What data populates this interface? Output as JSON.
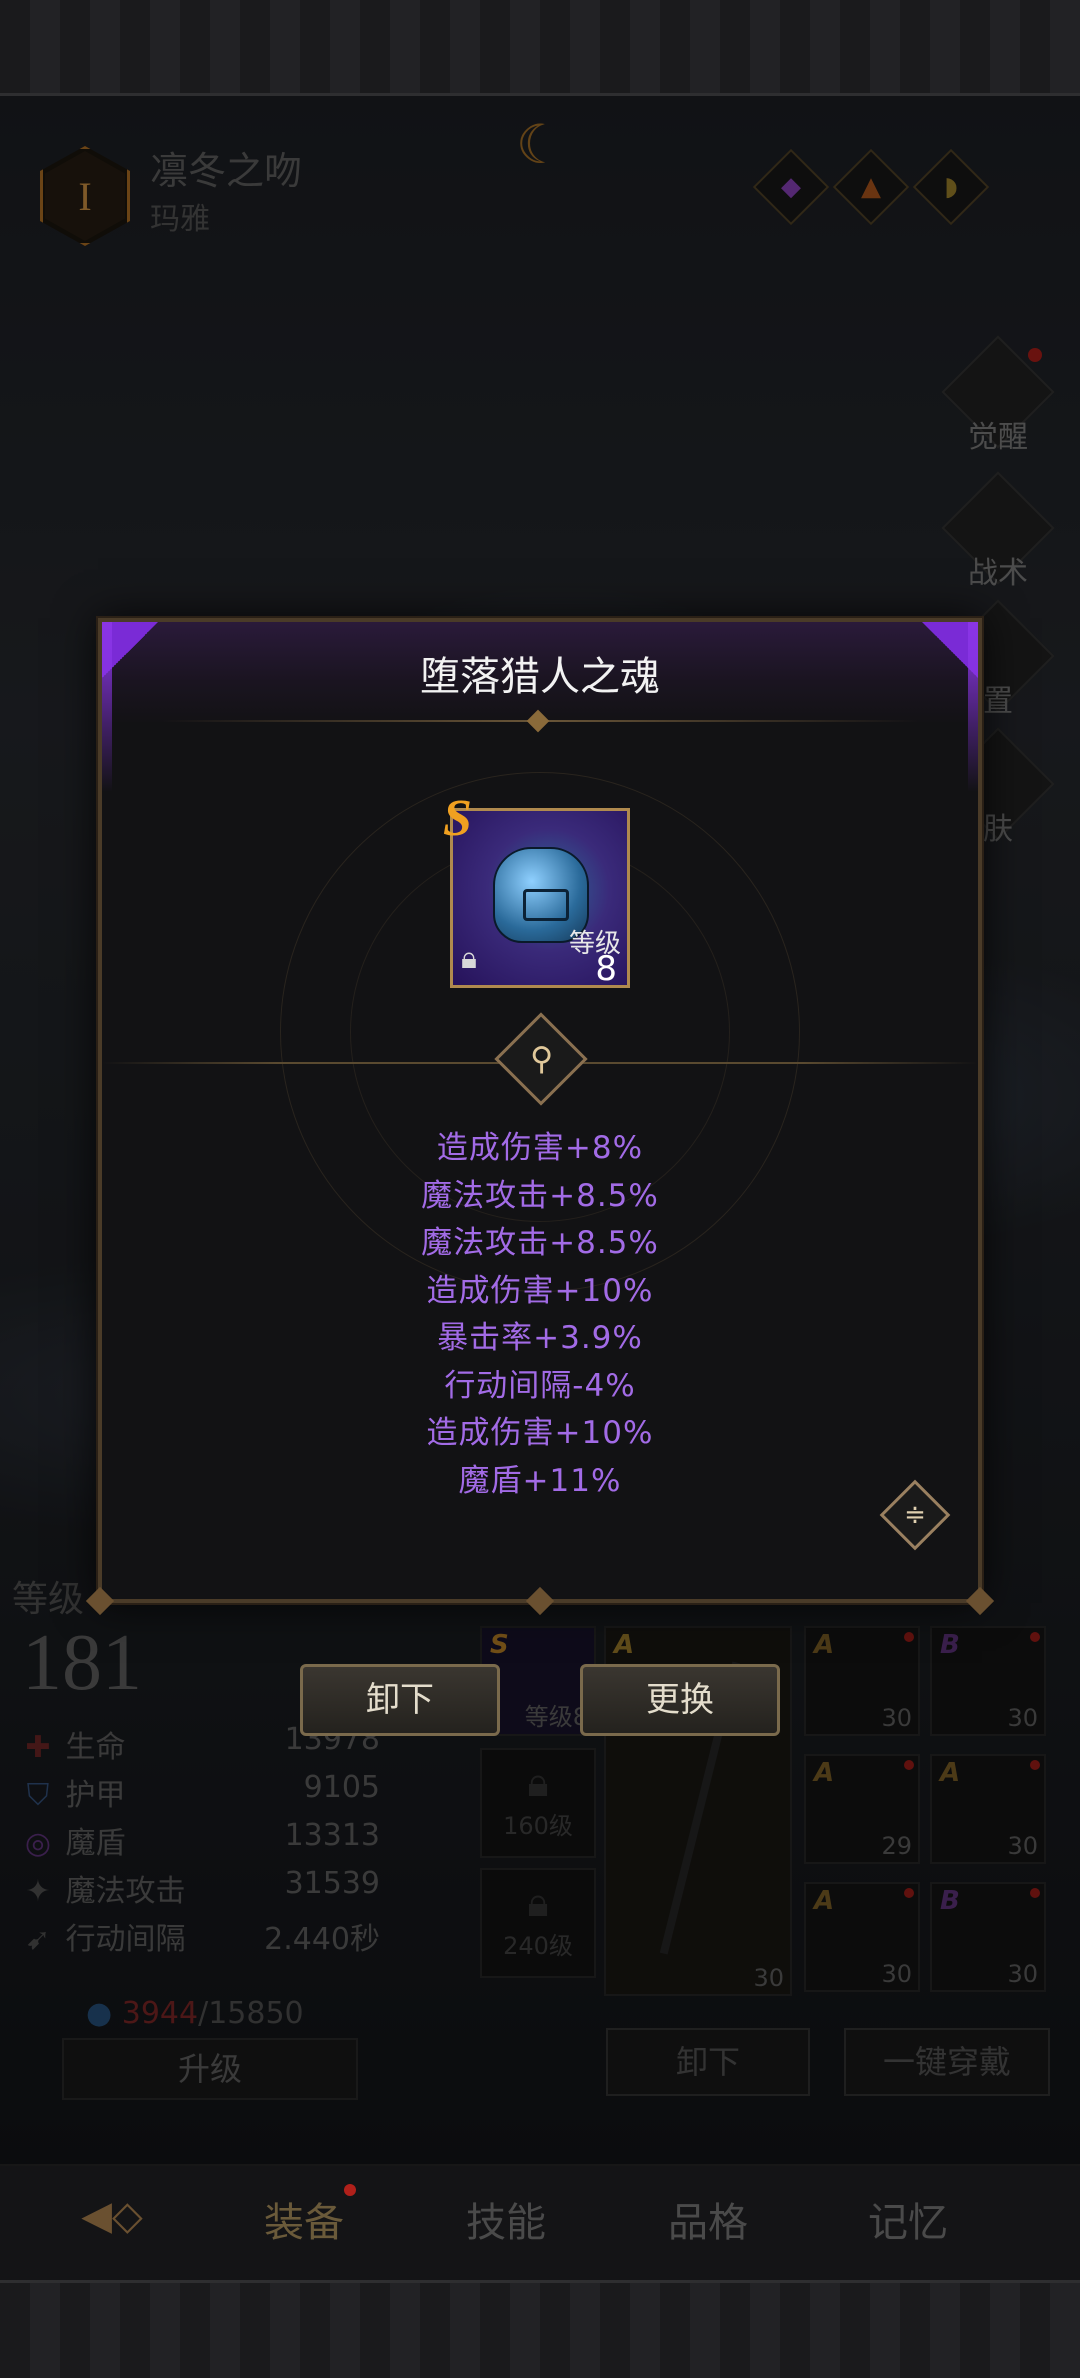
{
  "header": {
    "hero_name": "凛冬之吻",
    "hero_sub": "玛雅"
  },
  "side_menu": [
    {
      "label": "觉醒",
      "has_dot": true
    },
    {
      "label": "战术",
      "has_dot": false
    },
    {
      "label": "置",
      "has_dot": false
    },
    {
      "label": "肤",
      "has_dot": false
    }
  ],
  "modal": {
    "title": "堕落猎人之魂",
    "item": {
      "rank": "S",
      "level_label": "等级",
      "level": "8",
      "locked": true
    },
    "stats": [
      "造成伤害+8%",
      "魔法攻击+8.5%",
      "魔法攻击+8.5%",
      "造成伤害+10%",
      "暴击率+3.9%",
      "行动间隔-4%",
      "造成伤害+10%",
      "魔盾+11%"
    ]
  },
  "actions": {
    "unequip": "卸下",
    "replace": "更换"
  },
  "character": {
    "level_label": "等级",
    "level": "181",
    "stats": [
      {
        "icon": "health-icon",
        "label": "生命",
        "value": "13978"
      },
      {
        "icon": "armor-icon",
        "label": "护甲",
        "value": "9105"
      },
      {
        "icon": "shield-icon",
        "label": "魔盾",
        "value": "13313"
      },
      {
        "icon": "magic-attack-icon",
        "label": "魔法攻击",
        "value": "31539"
      },
      {
        "icon": "action-interval-icon",
        "label": "行动间隔",
        "value": "2.440秒"
      }
    ],
    "exp_current": "3944",
    "exp_total": "/15850",
    "upgrade_label": "升级"
  },
  "equipment": {
    "soul_slot_label": "等级8",
    "lock_slots": [
      "160级",
      "240级"
    ],
    "weapon": {
      "rank": "A",
      "level": "30"
    },
    "slots": [
      {
        "rank": "A",
        "level": "30",
        "rank_color": "#d8a640"
      },
      {
        "rank": "B",
        "level": "30",
        "rank_color": "#9a5ad0"
      },
      {
        "rank": "A",
        "level": "29",
        "rank_color": "#d8a640"
      },
      {
        "rank": "A",
        "level": "30",
        "rank_color": "#d8a640"
      },
      {
        "rank": "A",
        "level": "30",
        "rank_color": "#d8a640"
      },
      {
        "rank": "B",
        "level": "30",
        "rank_color": "#9a5ad0"
      }
    ],
    "unequip_all": "卸下",
    "equip_all": "一键穿戴"
  },
  "tabs": [
    {
      "label": "装备",
      "active": true,
      "has_dot": true
    },
    {
      "label": "技能",
      "active": false,
      "has_dot": false
    },
    {
      "label": "品格",
      "active": false,
      "has_dot": false
    },
    {
      "label": "记忆",
      "active": false,
      "has_dot": false
    }
  ],
  "colors": {
    "stat_text": "#a26be6",
    "rank_s": "#f0a020",
    "frame_gold": "#b08a4e"
  }
}
